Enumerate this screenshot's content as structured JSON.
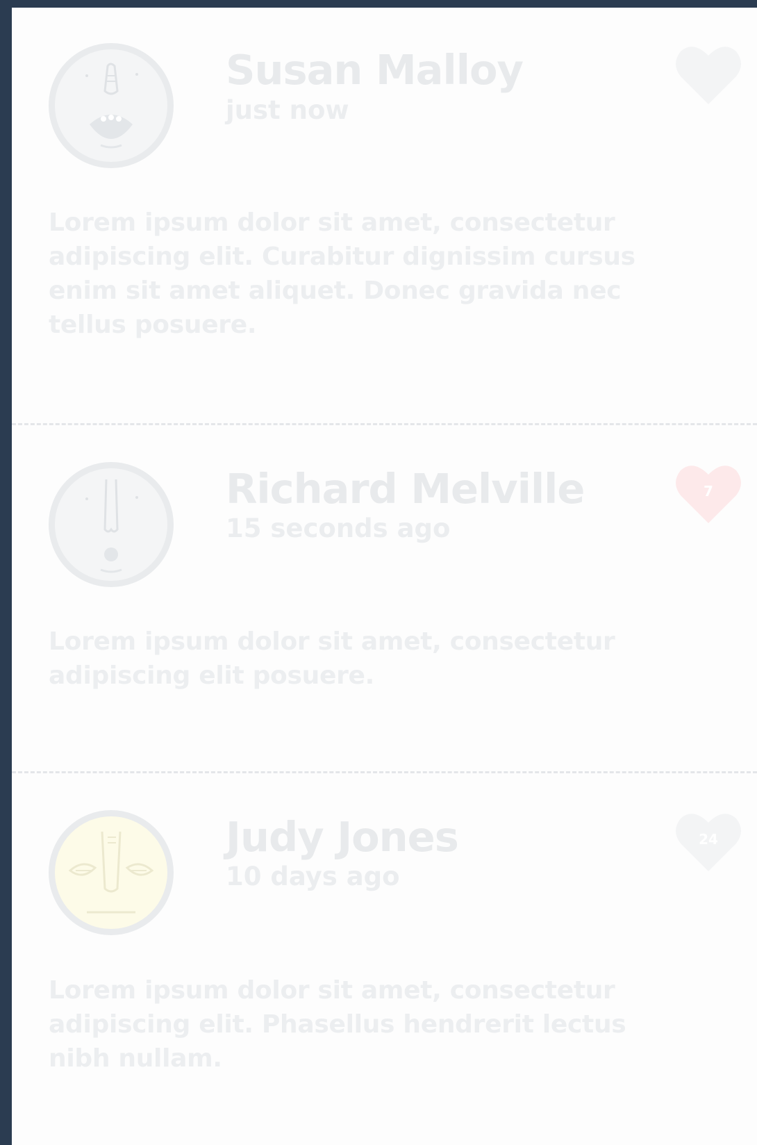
{
  "comments": [
    {
      "name": "Susan Malloy",
      "time": "just now",
      "likes": "",
      "liked": false,
      "avatar_icon": "grinning-face-icon",
      "body": "Lorem ipsum dolor sit amet, consectetur adipiscing elit. Curabitur dignissim cursus enim sit amet aliquet. Donec gravida nec tellus posuere."
    },
    {
      "name": "Richard Melville",
      "time": "15 seconds ago",
      "likes": "7",
      "liked": true,
      "avatar_icon": "surprised-face-icon",
      "body": "Lorem ipsum dolor sit amet, consectetur adipiscing elit posuere."
    },
    {
      "name": "Judy Jones",
      "time": "10 days ago",
      "likes": "24",
      "liked": false,
      "avatar_icon": "annoyed-face-icon",
      "body": "Lorem ipsum dolor sit amet, consectetur adipiscing elit. Phasellus hendrerit lectus nibh nullam."
    }
  ],
  "colors": {
    "background": "#2b3c51",
    "panel": "#fdfdfd",
    "heart_default": "#f3f4f5",
    "heart_liked": "#fde9ea",
    "text_faded": "#e8eaec",
    "avatar_yellow": "#fdfbe8"
  }
}
